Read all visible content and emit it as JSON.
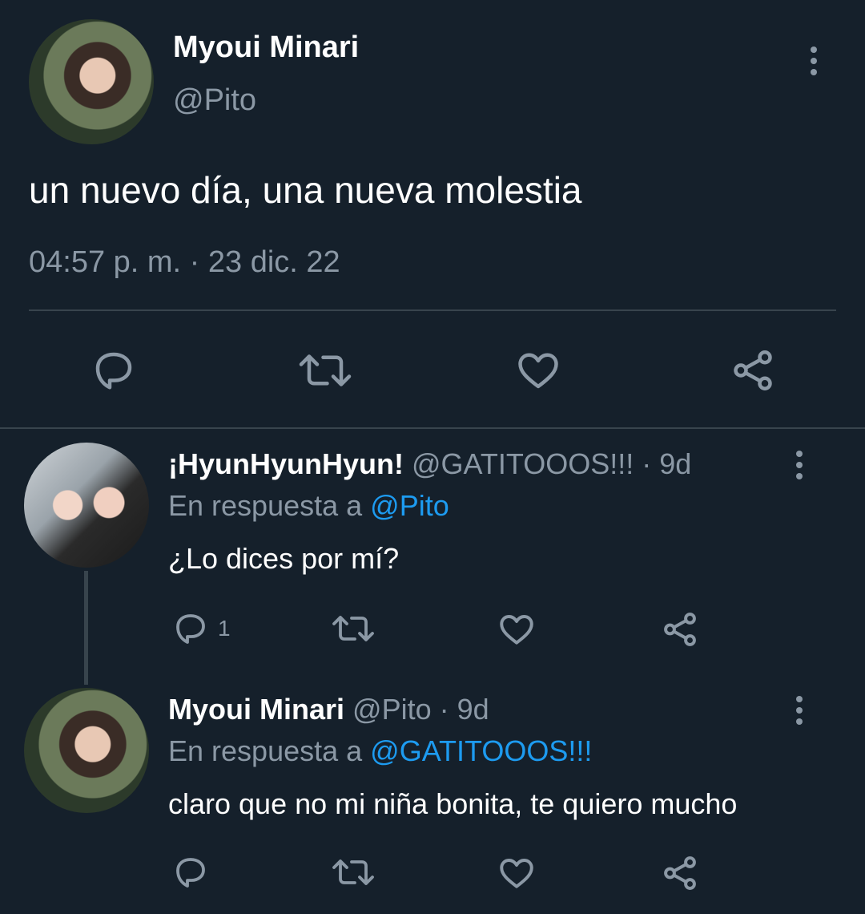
{
  "main_tweet": {
    "name": "Myoui Minari",
    "handle": "@Pito",
    "text": "un nuevo día, una nueva molestia",
    "timestamp": "04:57 p. m. · 23 dic. 22"
  },
  "replies": [
    {
      "name": "¡HyunHyunHyun!",
      "handle": "@GATITOOOS!!!",
      "age": "· 9d",
      "reply_prefix": "En respuesta a",
      "reply_to": "@Pito",
      "text": "¿Lo dices por mí?",
      "reply_count": "1"
    },
    {
      "name": "Myoui Minari",
      "handle": "@Pito",
      "age": "· 9d",
      "reply_prefix": "En respuesta a",
      "reply_to": "@GATITOOOS!!!",
      "text": "claro que no mi niña bonita, te quiero mucho",
      "reply_count": ""
    }
  ],
  "icons": {
    "reply": "reply-icon",
    "retweet": "retweet-icon",
    "like": "heart-icon",
    "share": "share-icon",
    "more": "more-vertical-icon"
  },
  "colors": {
    "background": "#15202b",
    "text": "#ffffff",
    "muted": "#8b98a5",
    "link": "#1d9bf0",
    "divider": "#38444d"
  }
}
